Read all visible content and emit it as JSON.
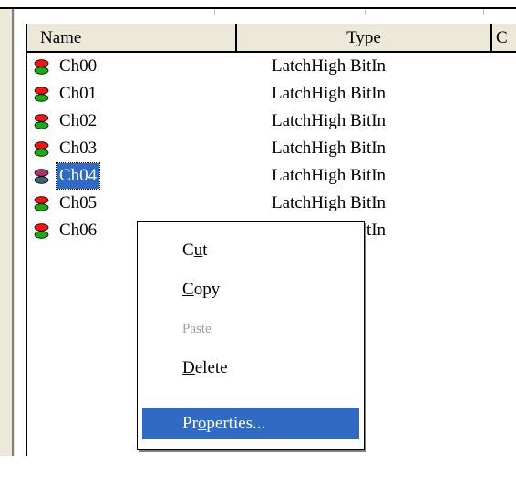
{
  "columns": {
    "name": "Name",
    "type": "Type",
    "third": "C"
  },
  "rows": [
    {
      "name": "Ch00",
      "type": "LatchHigh BitIn"
    },
    {
      "name": "Ch01",
      "type": "LatchHigh BitIn"
    },
    {
      "name": "Ch02",
      "type": "LatchHigh BitIn"
    },
    {
      "name": "Ch03",
      "type": "LatchHigh BitIn"
    },
    {
      "name": "Ch04",
      "type": "LatchHigh BitIn",
      "selected": true
    },
    {
      "name": "Ch05",
      "type": "LatchHigh BitIn"
    },
    {
      "name": "Ch06",
      "type": "LatchHigh BitIn"
    }
  ],
  "context_menu": {
    "items": [
      {
        "label": "Cut",
        "accelerator": "u",
        "enabled": true
      },
      {
        "label": "Copy",
        "accelerator": "C",
        "enabled": true
      },
      {
        "label": "Paste",
        "accelerator": "P",
        "enabled": false
      },
      {
        "label": "Delete",
        "accelerator": "D",
        "enabled": true
      },
      {
        "label": "Properties...",
        "accelerator": "o",
        "enabled": true,
        "highlighted": true
      }
    ]
  },
  "colors": {
    "selection": "#316ac5",
    "icon_red": "#ff1010",
    "icon_green": "#10b010",
    "icon_selected_top": "#b03070",
    "icon_selected_bottom": "#306a70"
  },
  "icons": {
    "row_icon": "led-indicator-icon"
  }
}
